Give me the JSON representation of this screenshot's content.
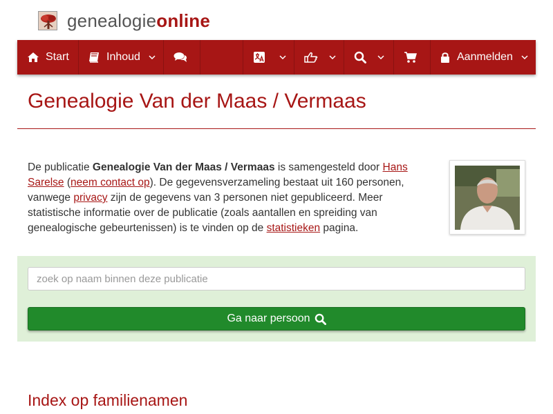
{
  "logo": {
    "part1": "genealogie",
    "part2": "online"
  },
  "nav": {
    "start_label": "Start",
    "content_label": "Inhoud",
    "login_label": "Aanmelden"
  },
  "page": {
    "title": "Genealogie Van der Maas / Vermaas"
  },
  "intro": {
    "t1": "De publicatie ",
    "pub_name": "Genealogie Van der Maas / Vermaas",
    "t2": " is samengesteld door ",
    "author_link": "Hans Sarelse",
    "t3": " (",
    "contact_link": "neem contact op",
    "t4": "). De gegevensverzameling bestaat uit 160 personen, vanwege ",
    "privacy_link": "privacy",
    "t5": " zijn de gegevens van 3 personen niet gepubliceerd. Meer statistische informatie over de publicatie (zoals aantallen en spreiding van genealogische gebeurtenissen) is te vinden op de ",
    "stats_link": "statistieken",
    "t6": " pagina."
  },
  "search": {
    "placeholder": "zoek op naam binnen deze publicatie",
    "button_label": "Ga naar persoon"
  },
  "index": {
    "heading": "Index op familienamen"
  },
  "colors": {
    "brand": "#a71615",
    "panel": "#dff0d8",
    "button": "#218a2b"
  },
  "icons": [
    "tree-logo-icon",
    "home-icon",
    "book-icon",
    "comments-icon",
    "translate-icon",
    "thumbs-up-icon",
    "search-icon",
    "cart-icon",
    "lock-icon",
    "chevron-down-icon"
  ]
}
